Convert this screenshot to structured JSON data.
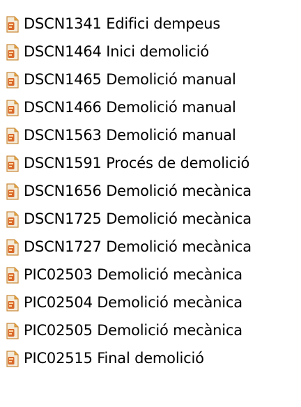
{
  "icon": "pdf-document-icon",
  "colors": {
    "background": "#ffffff",
    "text": "#000000",
    "icon_page": "#f4ead8",
    "icon_fold": "#e5a33b",
    "icon_badge": "#d9692a"
  },
  "files": [
    {
      "name": "DSCN1341 Edifici dempeus"
    },
    {
      "name": "DSCN1464 Inici demolició"
    },
    {
      "name": "DSCN1465 Demolició manual"
    },
    {
      "name": "DSCN1466 Demolició manual"
    },
    {
      "name": "DSCN1563 Demolició manual"
    },
    {
      "name": "DSCN1591 Procés de demolició"
    },
    {
      "name": "DSCN1656 Demolició mecànica"
    },
    {
      "name": "DSCN1725 Demolició mecànica"
    },
    {
      "name": "DSCN1727 Demolició mecànica"
    },
    {
      "name": "PIC02503 Demolició mecànica"
    },
    {
      "name": "PIC02504 Demolició mecànica"
    },
    {
      "name": "PIC02505 Demolició mecànica"
    },
    {
      "name": "PIC02515 Final demolició"
    }
  ]
}
